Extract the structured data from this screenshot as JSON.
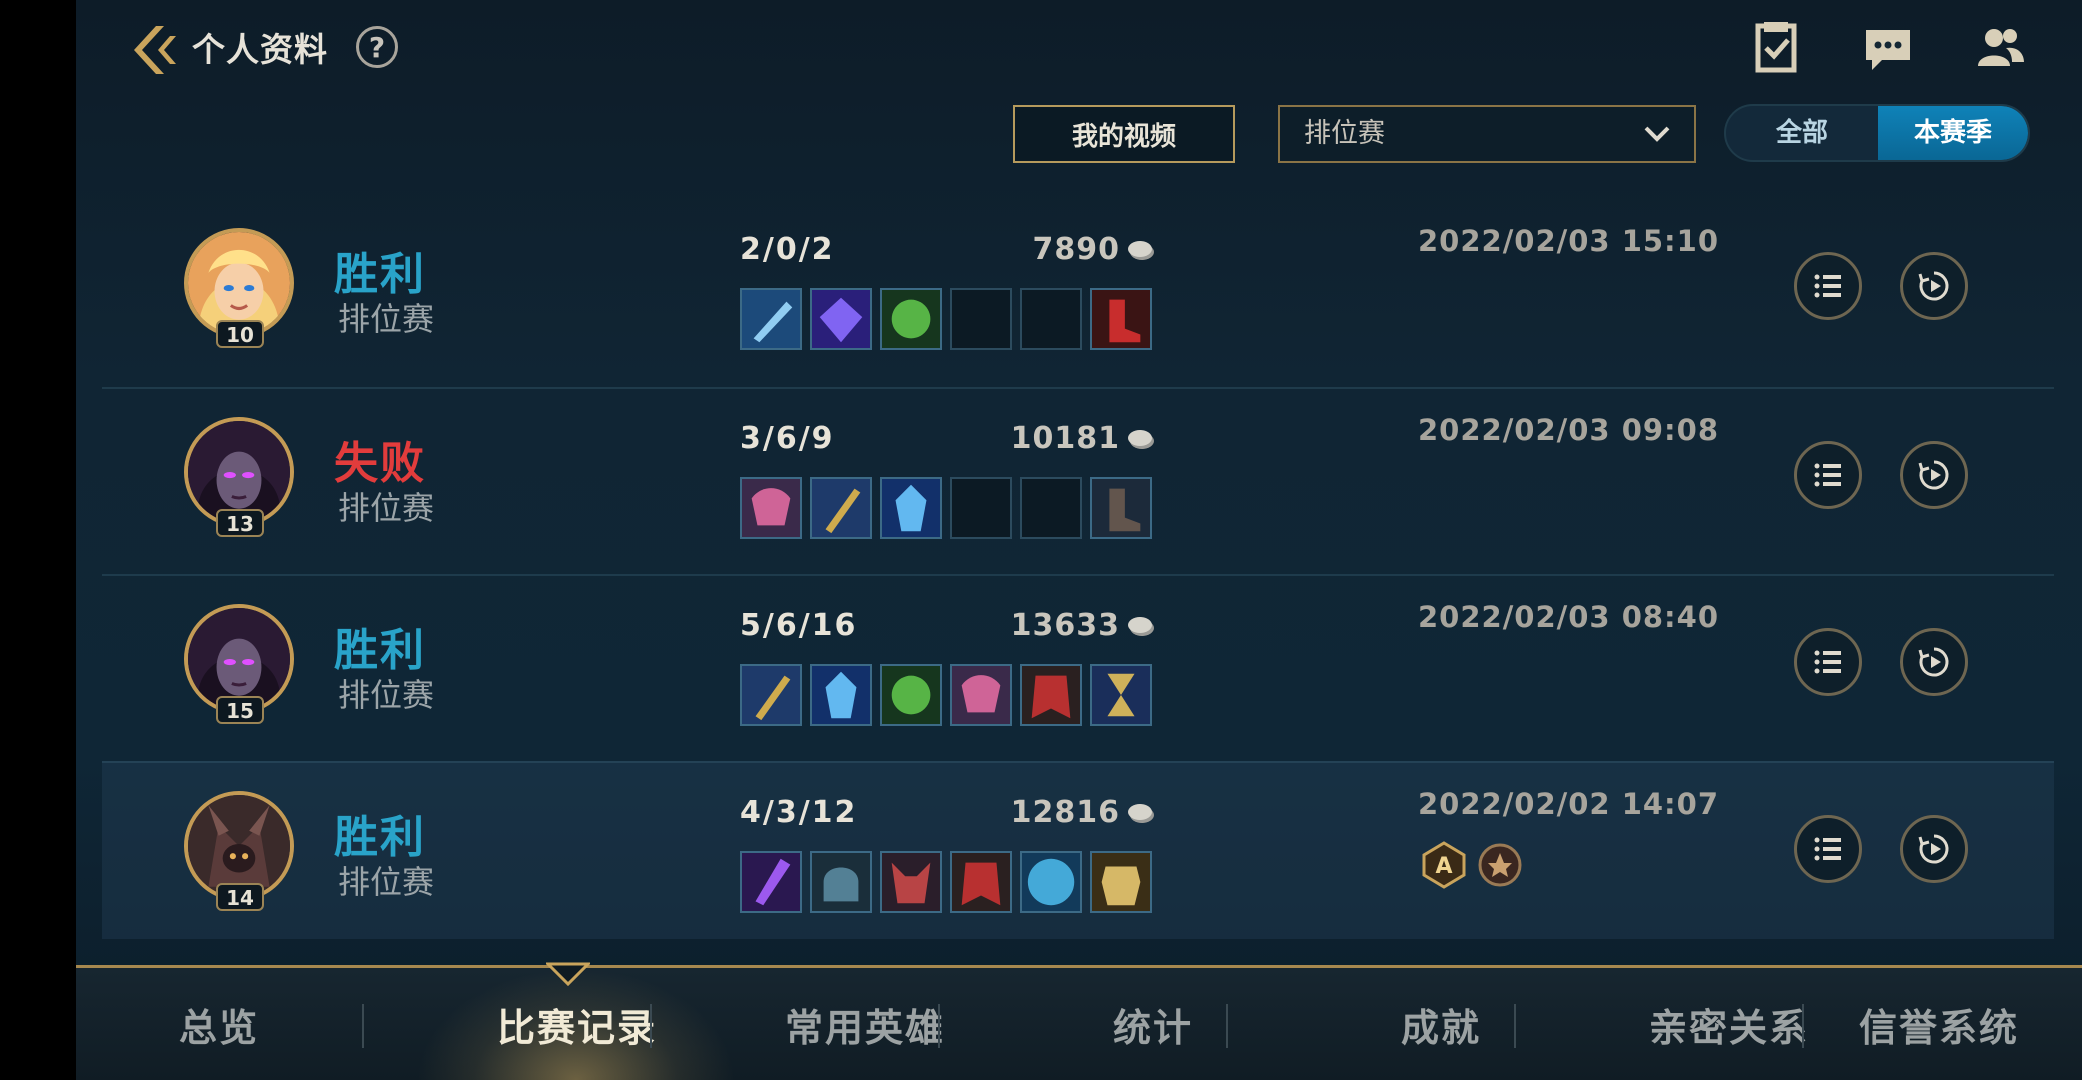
{
  "header": {
    "title": "个人资料",
    "help": "?"
  },
  "filters": {
    "my_videos_label": "我的视频",
    "mode_selected": "排位赛",
    "season_options": [
      "全部",
      "本赛季"
    ],
    "season_active": "本赛季"
  },
  "matches": [
    {
      "result": "胜利",
      "result_type": "win",
      "mode": "排位赛",
      "level": "10",
      "kda": "2/0/2",
      "gold": "7890",
      "datetime": "2022/02/03 15:10",
      "champion": "blonde-mage",
      "items": [
        "sword-item",
        "crystal-item",
        "green-orb-item",
        "empty",
        "empty",
        "red-boots-item"
      ],
      "badges": []
    },
    {
      "result": "失败",
      "result_type": "loss",
      "mode": "排位赛",
      "level": "13",
      "kda": "3/6/9",
      "gold": "10181",
      "datetime": "2022/02/03 09:08",
      "champion": "dark-sorceress",
      "items": [
        "pink-mask-item",
        "gold-staff-item",
        "ice-shard-item",
        "empty",
        "empty",
        "dark-boots-item"
      ],
      "badges": []
    },
    {
      "result": "胜利",
      "result_type": "win",
      "mode": "排位赛",
      "level": "15",
      "kda": "5/6/16",
      "gold": "13633",
      "datetime": "2022/02/03 08:40",
      "champion": "dark-sorceress",
      "items": [
        "gold-staff-item",
        "ice-shard-item",
        "green-orb-item",
        "pink-mask-item",
        "red-cape-item",
        "hourglass-item"
      ],
      "badges": []
    },
    {
      "result": "胜利",
      "result_type": "win",
      "mode": "排位赛",
      "level": "14",
      "kda": "4/3/12",
      "gold": "12816",
      "datetime": "2022/02/02 14:07",
      "champion": "void-beast",
      "items": [
        "purple-scythe-item",
        "dark-helm-item",
        "red-horned-item",
        "red-cape-item",
        "blue-shield-item",
        "gold-armor-item"
      ],
      "badges": [
        "A",
        "mvp"
      ]
    }
  ],
  "bottom_nav": {
    "tabs": [
      "总览",
      "比赛记录",
      "常用英雄",
      "统计",
      "成就",
      "亲密关系",
      "信誉系统"
    ],
    "active": "比赛记录"
  },
  "colors": {
    "win": "#29a3c9",
    "loss": "#e23c3c",
    "gold_accent": "#b59a5c",
    "season_active_bg": "#0f82b8"
  }
}
